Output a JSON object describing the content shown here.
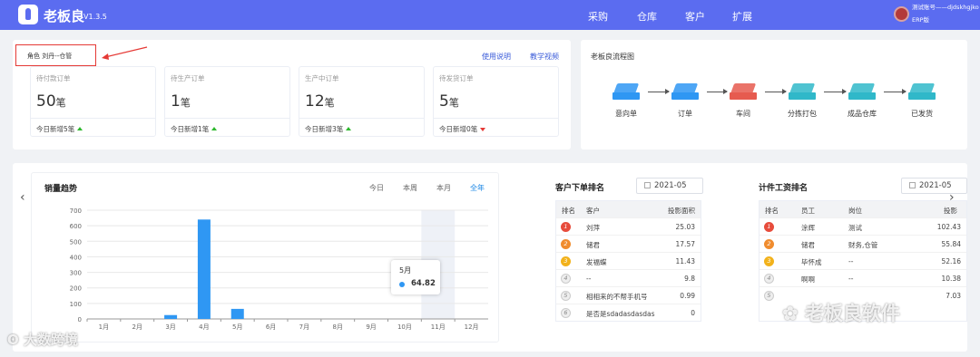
{
  "header": {
    "brand": "老板良",
    "version": "V1.3.5",
    "nav": [
      "采购",
      "仓库",
      "客户",
      "扩展"
    ],
    "user_name": "测试账号——djdskhgjko",
    "user_tag": "ERP版"
  },
  "role": {
    "label": "角色 刘丹--仓管"
  },
  "links": {
    "manual": "使用说明",
    "video": "教学视频"
  },
  "stats": [
    {
      "title": "待付款订单",
      "value": "50",
      "unit": "笔",
      "footer": "今日新增5笔",
      "trend": "up"
    },
    {
      "title": "待生产订单",
      "value": "1",
      "unit": "笔",
      "footer": "今日新增1笔",
      "trend": "up"
    },
    {
      "title": "生产中订单",
      "value": "12",
      "unit": "笔",
      "footer": "今日新增3笔",
      "trend": "up"
    },
    {
      "title": "待发货订单",
      "value": "5",
      "unit": "笔",
      "footer": "今日新增0笔",
      "trend": "down"
    }
  ],
  "flow": {
    "title": "老板良流程图",
    "steps": [
      {
        "label": "意向单",
        "icon": "intent-order-icon",
        "color": "#2f97f3"
      },
      {
        "label": "订单",
        "icon": "order-icon",
        "color": "#2f97f3"
      },
      {
        "label": "车间",
        "icon": "workshop-icon",
        "color": "#e65b4f"
      },
      {
        "label": "分拣打包",
        "icon": "package-icon",
        "color": "#30b8c9"
      },
      {
        "label": "成品仓库",
        "icon": "warehouse-icon",
        "color": "#30b8c9"
      },
      {
        "label": "已发货",
        "icon": "shipped-icon",
        "color": "#30b8c9"
      }
    ]
  },
  "sales": {
    "title": "销量趋势",
    "periods": [
      "今日",
      "本周",
      "本月",
      "全年"
    ],
    "active_period": "全年",
    "tooltip": {
      "month": "5月",
      "value": "64.82"
    }
  },
  "chart_data": {
    "type": "bar",
    "categories": [
      "1月",
      "2月",
      "3月",
      "4月",
      "5月",
      "6月",
      "7月",
      "8月",
      "9月",
      "10月",
      "11月",
      "12月"
    ],
    "values": [
      0,
      0,
      25,
      640,
      64.82,
      0,
      0,
      0,
      0,
      0,
      0,
      0
    ],
    "yticks": [
      0,
      100,
      200,
      300,
      400,
      500,
      600,
      700
    ],
    "ylim": [
      0,
      700
    ],
    "highlight_category": "11月",
    "color": "#2f97f3"
  },
  "customer_rank": {
    "title": "客户下单排名",
    "date": "2021-05",
    "headers": [
      "排名",
      "客户",
      "投影面积"
    ],
    "rows": [
      {
        "rank": "1",
        "name": "刘萍",
        "value": "25.03"
      },
      {
        "rank": "2",
        "name": "储君",
        "value": "17.57"
      },
      {
        "rank": "3",
        "name": "发福蝶",
        "value": "11.43"
      },
      {
        "rank": "4",
        "name": "--",
        "value": "9.8"
      },
      {
        "rank": "5",
        "name": "相相来的不帮手机号",
        "value": "0.99"
      },
      {
        "rank": "6",
        "name": "是否是sdadasdasdas",
        "value": "0"
      }
    ]
  },
  "wage_rank": {
    "title": "计件工资排名",
    "date": "2021-05",
    "headers": [
      "排名",
      "员工",
      "岗位",
      "投影"
    ],
    "rows": [
      {
        "rank": "1",
        "name": "涂辉",
        "post": "测试",
        "value": "102.43"
      },
      {
        "rank": "2",
        "name": "储君",
        "post": "财务,仓管",
        "value": "55.84"
      },
      {
        "rank": "3",
        "name": "毕怀成",
        "post": "--",
        "value": "52.16"
      },
      {
        "rank": "4",
        "name": "啊啊",
        "post": "--",
        "value": "10.38"
      },
      {
        "rank": "5",
        "name": "",
        "post": "",
        "value": "7.03"
      }
    ]
  },
  "watermarks": {
    "left": "大数跨境",
    "right": "老板良软件"
  }
}
